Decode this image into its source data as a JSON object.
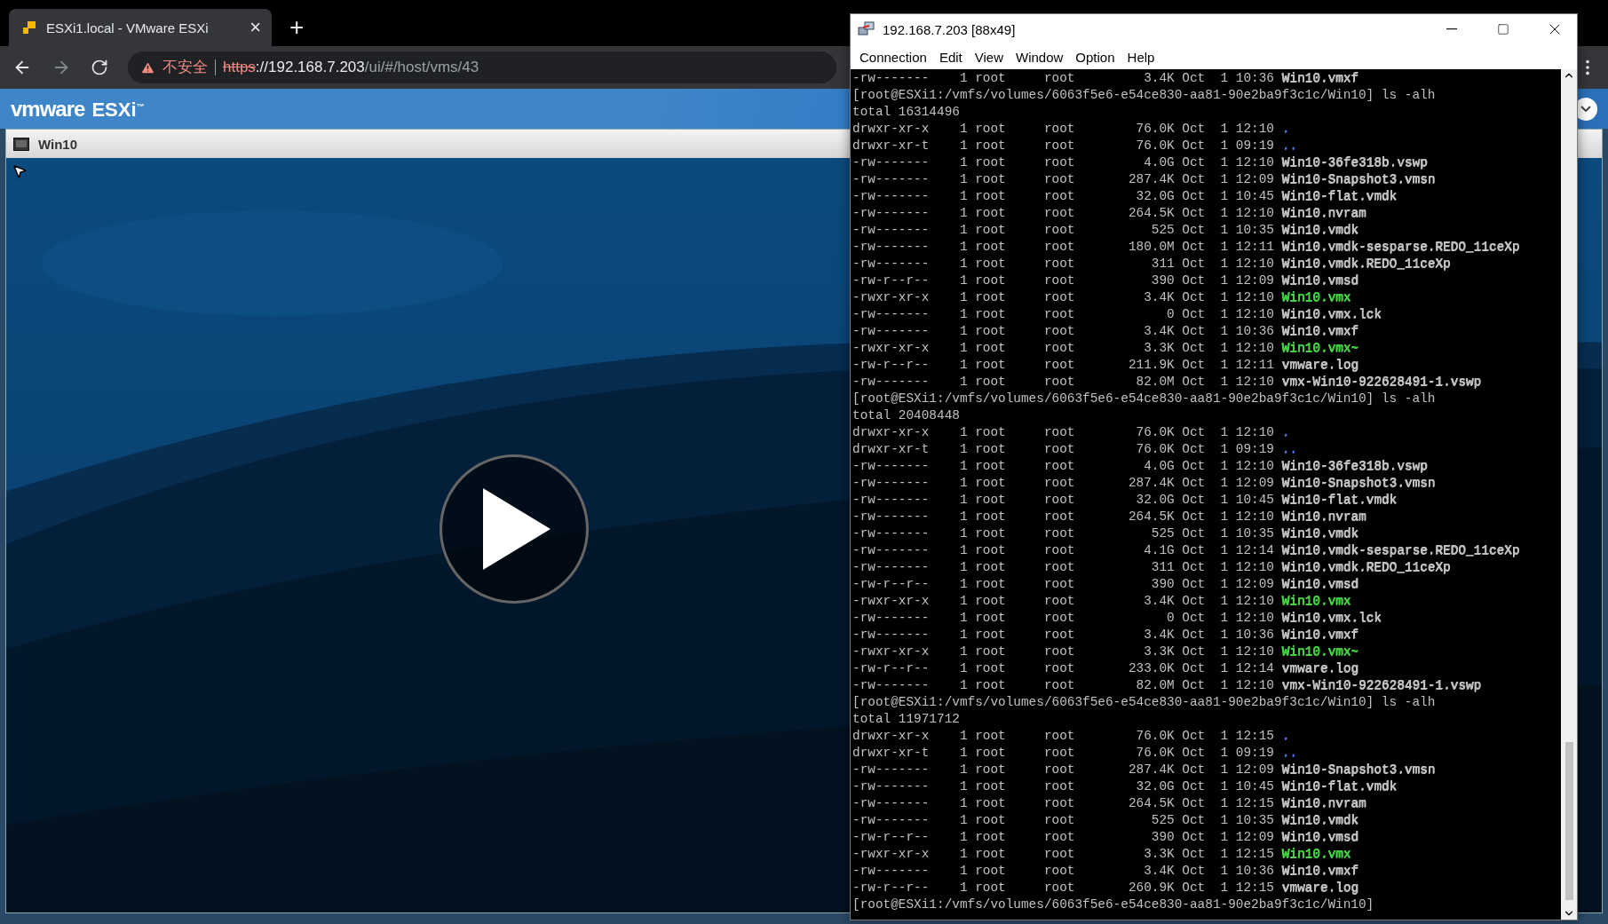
{
  "browser": {
    "tab": {
      "title": "ESXi1.local - VMware ESXi",
      "close": "×",
      "selected": true
    },
    "new_tab": "+",
    "security": "不安全",
    "url": {
      "scheme": "https",
      "host": "://192.168.7.203",
      "path": "/ui/#/host/vms/43"
    }
  },
  "header": {
    "brand": "vmware",
    "product": "ESXi",
    "mark": "™"
  },
  "console": {
    "title": "Win10"
  },
  "terminal": {
    "title": "192.168.7.203 [88x49]",
    "menu": [
      "Connection",
      "Edit",
      "View",
      "Window",
      "Option",
      "Help"
    ],
    "lines": [
      {
        "kind": "entry",
        "info": "-rw-------    1 root     root         3.4K Oct  1 10:36",
        "name": "Win10.vmxf",
        "color": "#c0c0c0"
      },
      {
        "kind": "prompt",
        "text": "[root@ESXi1:/vmfs/volumes/6063f5e6-e54ce830-aa81-90e2ba9f3c1c/Win10] ls -alh"
      },
      {
        "kind": "total",
        "text": "total 16314496"
      },
      {
        "kind": "entry",
        "info": "drwxr-xr-x    1 root     root        76.0K Oct  1 12:10",
        "name": ".",
        "color": "#4f6fd8"
      },
      {
        "kind": "entry",
        "info": "drwxr-xr-t    1 root     root        76.0K Oct  1 09:19",
        "name": "..",
        "color": "#4f6fd8"
      },
      {
        "kind": "entry",
        "info": "-rw-------    1 root     root         4.0G Oct  1 12:10",
        "name": "Win10-36fe318b.vswp",
        "color": "#c0c0c0"
      },
      {
        "kind": "entry",
        "info": "-rw-------    1 root     root       287.4K Oct  1 12:09",
        "name": "Win10-Snapshot3.vmsn",
        "color": "#c0c0c0"
      },
      {
        "kind": "entry",
        "info": "-rw-------    1 root     root        32.0G Oct  1 10:45",
        "name": "Win10-flat.vmdk",
        "color": "#c0c0c0"
      },
      {
        "kind": "entry",
        "info": "-rw-------    1 root     root       264.5K Oct  1 12:10",
        "name": "Win10.nvram",
        "color": "#c0c0c0"
      },
      {
        "kind": "entry",
        "info": "-rw-------    1 root     root          525 Oct  1 10:35",
        "name": "Win10.vmdk",
        "color": "#c0c0c0"
      },
      {
        "kind": "entry",
        "info": "-rw-------    1 root     root       180.0M Oct  1 12:11",
        "name": "Win10.vmdk-sesparse.REDO_11ceXp",
        "color": "#c0c0c0"
      },
      {
        "kind": "entry",
        "info": "-rw-------    1 root     root          311 Oct  1 12:10",
        "name": "Win10.vmdk.REDO_11ceXp",
        "color": "#c0c0c0"
      },
      {
        "kind": "entry",
        "info": "-rw-r--r--    1 root     root          390 Oct  1 12:09",
        "name": "Win10.vmsd",
        "color": "#c0c0c0"
      },
      {
        "kind": "entry",
        "info": "-rwxr-xr-x    1 root     root         3.4K Oct  1 12:10",
        "name": "Win10.vmx",
        "color": "#44d444"
      },
      {
        "kind": "entry",
        "info": "-rw-------    1 root     root            0 Oct  1 12:10",
        "name": "Win10.vmx.lck",
        "color": "#c0c0c0"
      },
      {
        "kind": "entry",
        "info": "-rw-------    1 root     root         3.4K Oct  1 10:36",
        "name": "Win10.vmxf",
        "color": "#c0c0c0"
      },
      {
        "kind": "entry",
        "info": "-rwxr-xr-x    1 root     root         3.3K Oct  1 12:10",
        "name": "Win10.vmx~",
        "color": "#44d444"
      },
      {
        "kind": "entry",
        "info": "-rw-r--r--    1 root     root       211.9K Oct  1 12:11",
        "name": "vmware.log",
        "color": "#c0c0c0"
      },
      {
        "kind": "entry",
        "info": "-rw-------    1 root     root        82.0M Oct  1 12:10",
        "name": "vmx-Win10-922628491-1.vswp",
        "color": "#c0c0c0"
      },
      {
        "kind": "prompt",
        "text": "[root@ESXi1:/vmfs/volumes/6063f5e6-e54ce830-aa81-90e2ba9f3c1c/Win10] ls -alh"
      },
      {
        "kind": "total",
        "text": "total 20408448"
      },
      {
        "kind": "entry",
        "info": "drwxr-xr-x    1 root     root        76.0K Oct  1 12:10",
        "name": ".",
        "color": "#4f6fd8"
      },
      {
        "kind": "entry",
        "info": "drwxr-xr-t    1 root     root        76.0K Oct  1 09:19",
        "name": "..",
        "color": "#4f6fd8"
      },
      {
        "kind": "entry",
        "info": "-rw-------    1 root     root         4.0G Oct  1 12:10",
        "name": "Win10-36fe318b.vswp",
        "color": "#c0c0c0"
      },
      {
        "kind": "entry",
        "info": "-rw-------    1 root     root       287.4K Oct  1 12:09",
        "name": "Win10-Snapshot3.vmsn",
        "color": "#c0c0c0"
      },
      {
        "kind": "entry",
        "info": "-rw-------    1 root     root        32.0G Oct  1 10:45",
        "name": "Win10-flat.vmdk",
        "color": "#c0c0c0"
      },
      {
        "kind": "entry",
        "info": "-rw-------    1 root     root       264.5K Oct  1 12:10",
        "name": "Win10.nvram",
        "color": "#c0c0c0"
      },
      {
        "kind": "entry",
        "info": "-rw-------    1 root     root          525 Oct  1 10:35",
        "name": "Win10.vmdk",
        "color": "#c0c0c0"
      },
      {
        "kind": "entry",
        "info": "-rw-------    1 root     root         4.1G Oct  1 12:14",
        "name": "Win10.vmdk-sesparse.REDO_11ceXp",
        "color": "#c0c0c0"
      },
      {
        "kind": "entry",
        "info": "-rw-------    1 root     root          311 Oct  1 12:10",
        "name": "Win10.vmdk.REDO_11ceXp",
        "color": "#c0c0c0"
      },
      {
        "kind": "entry",
        "info": "-rw-r--r--    1 root     root          390 Oct  1 12:09",
        "name": "Win10.vmsd",
        "color": "#c0c0c0"
      },
      {
        "kind": "entry",
        "info": "-rwxr-xr-x    1 root     root         3.4K Oct  1 12:10",
        "name": "Win10.vmx",
        "color": "#44d444"
      },
      {
        "kind": "entry",
        "info": "-rw-------    1 root     root            0 Oct  1 12:10",
        "name": "Win10.vmx.lck",
        "color": "#c0c0c0"
      },
      {
        "kind": "entry",
        "info": "-rw-------    1 root     root         3.4K Oct  1 10:36",
        "name": "Win10.vmxf",
        "color": "#c0c0c0"
      },
      {
        "kind": "entry",
        "info": "-rwxr-xr-x    1 root     root         3.3K Oct  1 12:10",
        "name": "Win10.vmx~",
        "color": "#44d444"
      },
      {
        "kind": "entry",
        "info": "-rw-r--r--    1 root     root       233.0K Oct  1 12:14",
        "name": "vmware.log",
        "color": "#c0c0c0"
      },
      {
        "kind": "entry",
        "info": "-rw-------    1 root     root        82.0M Oct  1 12:10",
        "name": "vmx-Win10-922628491-1.vswp",
        "color": "#c0c0c0"
      },
      {
        "kind": "prompt",
        "text": "[root@ESXi1:/vmfs/volumes/6063f5e6-e54ce830-aa81-90e2ba9f3c1c/Win10] ls -alh"
      },
      {
        "kind": "total",
        "text": "total 11971712"
      },
      {
        "kind": "entry",
        "info": "drwxr-xr-x    1 root     root        76.0K Oct  1 12:15",
        "name": ".",
        "color": "#4f6fd8"
      },
      {
        "kind": "entry",
        "info": "drwxr-xr-t    1 root     root        76.0K Oct  1 09:19",
        "name": "..",
        "color": "#4f6fd8"
      },
      {
        "kind": "entry",
        "info": "-rw-------    1 root     root       287.4K Oct  1 12:09",
        "name": "Win10-Snapshot3.vmsn",
        "color": "#c0c0c0"
      },
      {
        "kind": "entry",
        "info": "-rw-------    1 root     root        32.0G Oct  1 10:45",
        "name": "Win10-flat.vmdk",
        "color": "#c0c0c0"
      },
      {
        "kind": "entry",
        "info": "-rw-------    1 root     root       264.5K Oct  1 12:15",
        "name": "Win10.nvram",
        "color": "#c0c0c0"
      },
      {
        "kind": "entry",
        "info": "-rw-------    1 root     root          525 Oct  1 10:35",
        "name": "Win10.vmdk",
        "color": "#c0c0c0"
      },
      {
        "kind": "entry",
        "info": "-rw-r--r--    1 root     root          390 Oct  1 12:09",
        "name": "Win10.vmsd",
        "color": "#c0c0c0"
      },
      {
        "kind": "entry",
        "info": "-rwxr-xr-x    1 root     root         3.3K Oct  1 12:15",
        "name": "Win10.vmx",
        "color": "#44d444"
      },
      {
        "kind": "entry",
        "info": "-rw-------    1 root     root         3.4K Oct  1 10:36",
        "name": "Win10.vmxf",
        "color": "#c0c0c0"
      },
      {
        "kind": "entry",
        "info": "-rw-r--r--    1 root     root       260.9K Oct  1 12:15",
        "name": "vmware.log",
        "color": "#c0c0c0"
      },
      {
        "kind": "prompt",
        "text": "[root@ESXi1:/vmfs/volumes/6063f5e6-e54ce830-aa81-90e2ba9f3c1c/Win10]"
      }
    ]
  }
}
